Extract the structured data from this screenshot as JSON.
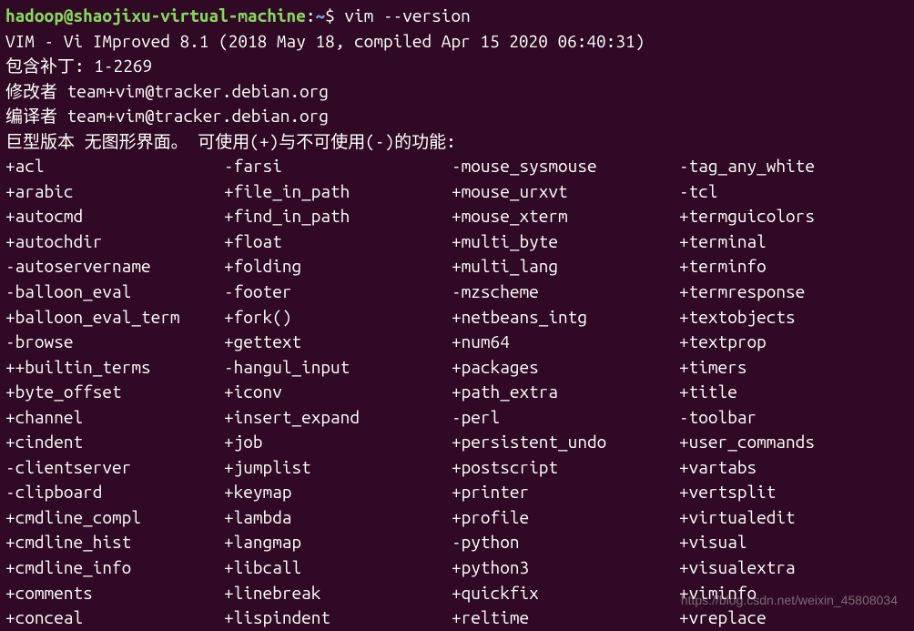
{
  "prompt": {
    "user_host": "hadoop@shaojixu-virtual-machine",
    "colon": ":",
    "path": "~",
    "dollar": "$",
    "command": " vim --version"
  },
  "header": {
    "line1": "VIM - Vi IMproved 8.1 (2018 May 18, compiled Apr 15 2020 06:40:31)",
    "line2": "包含补丁: 1-2269",
    "line3": "修改者 team+vim@tracker.debian.org",
    "line4": "编译者 team+vim@tracker.debian.org",
    "line5": "巨型版本 无图形界面。  可使用(+)与不可使用(-)的功能:"
  },
  "features": [
    {
      "c1": "+acl",
      "c2": "-farsi",
      "c3": "-mouse_sysmouse",
      "c4": "-tag_any_white"
    },
    {
      "c1": "+arabic",
      "c2": "+file_in_path",
      "c3": "+mouse_urxvt",
      "c4": "-tcl"
    },
    {
      "c1": "+autocmd",
      "c2": "+find_in_path",
      "c3": "+mouse_xterm",
      "c4": "+termguicolors"
    },
    {
      "c1": "+autochdir",
      "c2": "+float",
      "c3": "+multi_byte",
      "c4": "+terminal"
    },
    {
      "c1": "-autoservername",
      "c2": "+folding",
      "c3": "+multi_lang",
      "c4": "+terminfo"
    },
    {
      "c1": "-balloon_eval",
      "c2": "-footer",
      "c3": "-mzscheme",
      "c4": "+termresponse"
    },
    {
      "c1": "+balloon_eval_term",
      "c2": "+fork()",
      "c3": "+netbeans_intg",
      "c4": "+textobjects"
    },
    {
      "c1": "-browse",
      "c2": "+gettext",
      "c3": "+num64",
      "c4": "+textprop"
    },
    {
      "c1": "++builtin_terms",
      "c2": "-hangul_input",
      "c3": "+packages",
      "c4": "+timers"
    },
    {
      "c1": "+byte_offset",
      "c2": "+iconv",
      "c3": "+path_extra",
      "c4": "+title"
    },
    {
      "c1": "+channel",
      "c2": "+insert_expand",
      "c3": "-perl",
      "c4": "-toolbar"
    },
    {
      "c1": "+cindent",
      "c2": "+job",
      "c3": "+persistent_undo",
      "c4": "+user_commands"
    },
    {
      "c1": "-clientserver",
      "c2": "+jumplist",
      "c3": "+postscript",
      "c4": "+vartabs"
    },
    {
      "c1": "-clipboard",
      "c2": "+keymap",
      "c3": "+printer",
      "c4": "+vertsplit"
    },
    {
      "c1": "+cmdline_compl",
      "c2": "+lambda",
      "c3": "+profile",
      "c4": "+virtualedit"
    },
    {
      "c1": "+cmdline_hist",
      "c2": "+langmap",
      "c3": "-python",
      "c4": "+visual"
    },
    {
      "c1": "+cmdline_info",
      "c2": "+libcall",
      "c3": "+python3",
      "c4": "+visualextra"
    },
    {
      "c1": "+comments",
      "c2": "+linebreak",
      "c3": "+quickfix",
      "c4": "+viminfo"
    },
    {
      "c1": "+conceal",
      "c2": "+lispindent",
      "c3": "+reltime",
      "c4": "+vreplace"
    }
  ],
  "watermark": "https://blog.csdn.net/weixin_45808034"
}
